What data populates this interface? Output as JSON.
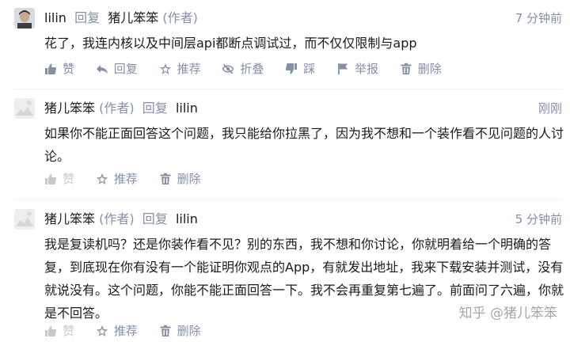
{
  "comments": [
    {
      "author": "lilin",
      "reply_word": "回复",
      "reply_to": "猪儿笨笨",
      "author_tag": "",
      "reply_to_tag": "(作者)",
      "time": "7 分钟前",
      "text": "花了，我连内核以及中间层api都断点调试过，而不仅仅限制与app",
      "actions": [
        "赞",
        "回复",
        "推荐",
        "折叠",
        "踩",
        "举报",
        "删除"
      ]
    },
    {
      "author": "猪儿笨笨",
      "author_tag": "(作者)",
      "reply_word": "回复",
      "reply_to": "lilin",
      "reply_to_tag": "",
      "time": "刚刚",
      "text": "如果你不能正面回答这个问题，我只能给你拉黑了，因为我不想和一个装作看不见问题的人讨论。",
      "actions": [
        "赞",
        "推荐",
        "删除"
      ]
    },
    {
      "author": "猪儿笨笨",
      "author_tag": "(作者)",
      "reply_word": "回复",
      "reply_to": "lilin",
      "reply_to_tag": "",
      "time": "5 分钟前",
      "text": "我是复读机吗？还是你装作看不见？别的东西，我不想和你讨论，你就明着给一个明确的答复，到底现在你有没有一个能证明你观点的App，有就发出地址，我来下载安装并测试，没有就说没有。这个问题，你能不能正面回答一下。我不会再重复第七遍了。前面问了六遍，你就是不回答。",
      "actions": [
        "赞",
        "推荐",
        "删除"
      ]
    }
  ],
  "watermark": "知乎 @猪儿笨笨",
  "colors": {
    "meta": "#8590a6",
    "text": "#1a1a1a",
    "dim": "#c5c9d3"
  }
}
